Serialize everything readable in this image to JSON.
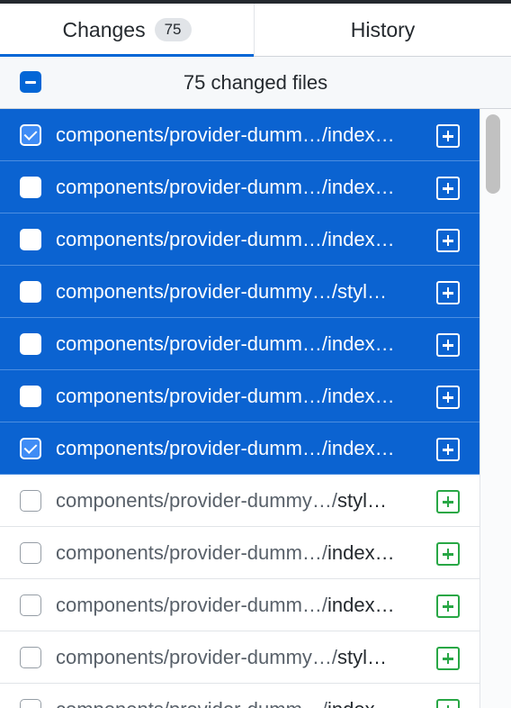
{
  "tabs": {
    "changes_label": "Changes",
    "changes_count": "75",
    "history_label": "History"
  },
  "header": {
    "summary": "75 changed files"
  },
  "colors": {
    "accent": "#0366d6",
    "selected_row": "#0b63d1",
    "added_status": "#28a745"
  },
  "files": [
    {
      "dir": "components/provider-dumm…/",
      "file": "index…",
      "checked": true,
      "selected": true,
      "status_icon": "added-icon"
    },
    {
      "dir": "components/provider-dumm…/",
      "file": "index…",
      "checked": false,
      "selected": true,
      "status_icon": "added-icon"
    },
    {
      "dir": "components/provider-dumm…/",
      "file": "index…",
      "checked": false,
      "selected": true,
      "status_icon": "added-icon"
    },
    {
      "dir": "components/provider-dummy…/",
      "file": "styl…",
      "checked": false,
      "selected": true,
      "status_icon": "added-icon"
    },
    {
      "dir": "components/provider-dumm…/",
      "file": "index…",
      "checked": false,
      "selected": true,
      "status_icon": "added-icon"
    },
    {
      "dir": "components/provider-dumm…/",
      "file": "index…",
      "checked": false,
      "selected": true,
      "status_icon": "added-icon"
    },
    {
      "dir": "components/provider-dumm…/",
      "file": "index…",
      "checked": true,
      "selected": true,
      "status_icon": "added-icon"
    },
    {
      "dir": "components/provider-dummy…/",
      "file": "styl…",
      "checked": false,
      "selected": false,
      "status_icon": "added-icon"
    },
    {
      "dir": "components/provider-dumm…/",
      "file": "index…",
      "checked": false,
      "selected": false,
      "status_icon": "added-icon"
    },
    {
      "dir": "components/provider-dumm…/",
      "file": "index…",
      "checked": false,
      "selected": false,
      "status_icon": "added-icon"
    },
    {
      "dir": "components/provider-dummy…/",
      "file": "styl…",
      "checked": false,
      "selected": false,
      "status_icon": "added-icon"
    },
    {
      "dir": "components/provider-dumm…/",
      "file": "index…",
      "checked": false,
      "selected": false,
      "status_icon": "added-icon"
    }
  ]
}
